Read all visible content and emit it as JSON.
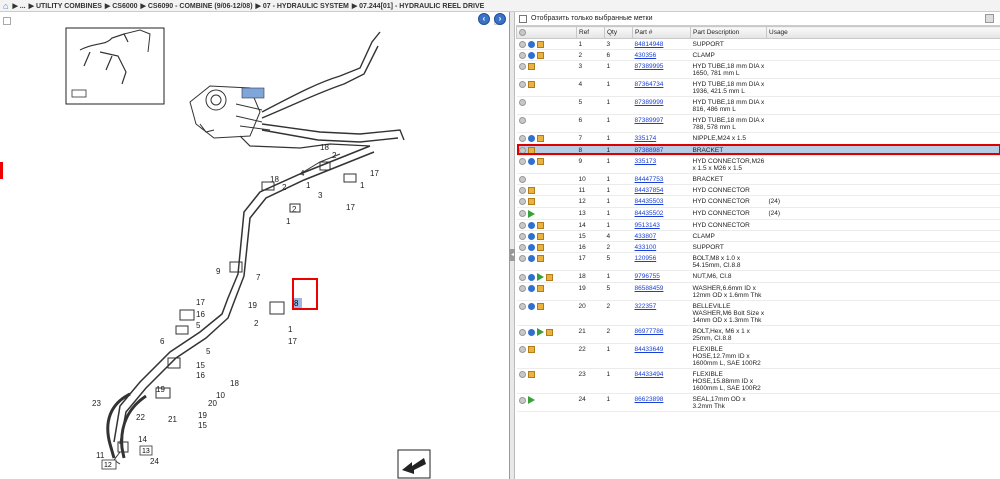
{
  "breadcrumb": {
    "items": [
      "...",
      "UTILITY COMBINES",
      "CS6000",
      "CS6090 - COMBINE (9/06-12/08)",
      "07 - HYDRAULIC SYSTEM",
      "07.244[01] - HYDRAULIC REEL DRIVE"
    ]
  },
  "filter": {
    "label": "Отобразить только выбранные метки"
  },
  "table": {
    "headers": [
      "Ref",
      "Qty",
      "Part #",
      "Part Description",
      "Usage"
    ],
    "rows": [
      {
        "ref": "1",
        "qty": "3",
        "part": "84814948",
        "desc": "SUPPORT",
        "usage": "",
        "icons": [
          "plus",
          "info",
          "box"
        ]
      },
      {
        "ref": "2",
        "qty": "6",
        "part": "430356",
        "desc": "CLAMP",
        "usage": "",
        "icons": [
          "plus",
          "info",
          "box"
        ]
      },
      {
        "ref": "3",
        "qty": "1",
        "part": "87389995",
        "desc": "HYD TUBE,18 mm DIA x 1650, 781 mm L",
        "usage": "",
        "icons": [
          "plus",
          "box"
        ]
      },
      {
        "ref": "4",
        "qty": "1",
        "part": "87364734",
        "desc": "HYD TUBE,18 mm DIA x 1936, 421.5 mm L",
        "usage": "",
        "icons": [
          "plus",
          "box"
        ]
      },
      {
        "ref": "5",
        "qty": "1",
        "part": "87389999",
        "desc": "HYD TUBE,18 mm DIA x 816, 486 mm L",
        "usage": "",
        "icons": [
          "plus"
        ]
      },
      {
        "ref": "6",
        "qty": "1",
        "part": "87389997",
        "desc": "HYD TUBE,18 mm DIA x 788, 578 mm L",
        "usage": "",
        "icons": [
          "plus"
        ]
      },
      {
        "ref": "7",
        "qty": "1",
        "part": "335174",
        "desc": "NIPPLE,M24 x 1.5",
        "usage": "",
        "icons": [
          "plus",
          "info",
          "box"
        ]
      },
      {
        "ref": "8",
        "qty": "1",
        "part": "87388987",
        "desc": "BRACKET",
        "usage": "",
        "icons": [
          "plus",
          "box"
        ],
        "selected": true
      },
      {
        "ref": "9",
        "qty": "1",
        "part": "335173",
        "desc": "HYD CONNECTOR,M26 x 1.5 x M26 x 1.5",
        "usage": "",
        "icons": [
          "plus",
          "info",
          "box"
        ]
      },
      {
        "ref": "10",
        "qty": "1",
        "part": "84447753",
        "desc": "BRACKET",
        "usage": "",
        "icons": [
          "plus"
        ]
      },
      {
        "ref": "11",
        "qty": "1",
        "part": "84437854",
        "desc": "HYD CONNECTOR",
        "usage": "",
        "icons": [
          "plus",
          "box"
        ]
      },
      {
        "ref": "12",
        "qty": "1",
        "part": "84435503",
        "desc": "HYD CONNECTOR",
        "usage": "(24)",
        "icons": [
          "plus",
          "box"
        ]
      },
      {
        "ref": "13",
        "qty": "1",
        "part": "84435502",
        "desc": "HYD CONNECTOR",
        "usage": "(24)",
        "icons": [
          "plus",
          "arrow"
        ]
      },
      {
        "ref": "14",
        "qty": "1",
        "part": "9513143",
        "desc": "HYD CONNECTOR",
        "usage": "",
        "icons": [
          "plus",
          "info",
          "box"
        ]
      },
      {
        "ref": "15",
        "qty": "4",
        "part": "433807",
        "desc": "CLAMP",
        "usage": "",
        "icons": [
          "plus",
          "info",
          "box"
        ]
      },
      {
        "ref": "16",
        "qty": "2",
        "part": "433100",
        "desc": "SUPPORT",
        "usage": "",
        "icons": [
          "plus",
          "info",
          "box"
        ]
      },
      {
        "ref": "17",
        "qty": "5",
        "part": "120956",
        "desc": "BOLT,M8 x 1.0 x 54.15mm, CI.8.8",
        "usage": "",
        "icons": [
          "plus",
          "info",
          "box"
        ]
      },
      {
        "ref": "18",
        "qty": "1",
        "part": "9796755",
        "desc": "NUT,M6, CI.8",
        "usage": "",
        "icons": [
          "plus",
          "info",
          "arrow",
          "box"
        ]
      },
      {
        "ref": "19",
        "qty": "5",
        "part": "86588459",
        "desc": "WASHER,6.6mm ID x 12mm OD x 1.6mm Thk",
        "usage": "",
        "icons": [
          "plus",
          "info",
          "box"
        ]
      },
      {
        "ref": "20",
        "qty": "2",
        "part": "322357",
        "desc": "BELLEVILLE WASHER,M6 Bolt Size x 14mm OD x 1.3mm Thk",
        "usage": "",
        "icons": [
          "plus",
          "info",
          "box"
        ]
      },
      {
        "ref": "21",
        "qty": "2",
        "part": "86977786",
        "desc": "BOLT,Hex, M6 x 1 x 25mm, CI.8.8",
        "usage": "",
        "icons": [
          "plus",
          "info",
          "arrow",
          "box"
        ]
      },
      {
        "ref": "22",
        "qty": "1",
        "part": "84433649",
        "desc": "FLEXIBLE HOSE,12.7mm ID x 1600mm L, SAE 100R2",
        "usage": "",
        "icons": [
          "plus",
          "box"
        ]
      },
      {
        "ref": "23",
        "qty": "1",
        "part": "84433494",
        "desc": "FLEXIBLE HOSE,15.88mm ID x 1600mm L, SAE 100R2",
        "usage": "",
        "icons": [
          "plus",
          "box"
        ]
      },
      {
        "ref": "24",
        "qty": "1",
        "part": "86623898",
        "desc": "SEAL,17mm OD x 3.2mm Thk",
        "usage": "",
        "icons": [
          "plus",
          "arrow"
        ]
      }
    ]
  },
  "diagram": {
    "callouts": [
      "1",
      "2",
      "3",
      "4",
      "5",
      "6",
      "7",
      "8",
      "9",
      "10",
      "11",
      "12",
      "13",
      "14",
      "15",
      "16",
      "17",
      "18",
      "19",
      "20",
      "21",
      "22",
      "23",
      "24"
    ]
  }
}
